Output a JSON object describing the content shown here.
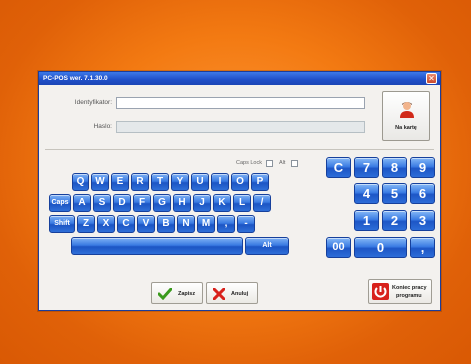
{
  "window": {
    "title": "PC-POS wer. 7.1.30.0",
    "close_glyph": "✕"
  },
  "login": {
    "identyfikator_label": "Identyfikator:",
    "identyfikator_value": "",
    "haslo_label": "Haslo:",
    "haslo_value": "",
    "card_button_label": "Na kartę",
    "card_icon": "user-icon"
  },
  "keyboard": {
    "caps_lock_label": "Caps Lock",
    "alt_label": "Alt",
    "row1": [
      "Q",
      "W",
      "E",
      "R",
      "T",
      "Y",
      "U",
      "I",
      "O",
      "P"
    ],
    "row2": [
      "Caps",
      "A",
      "S",
      "D",
      "F",
      "G",
      "H",
      "J",
      "K",
      "L",
      "/"
    ],
    "row3": [
      "Shift",
      "Z",
      "X",
      "C",
      "V",
      "B",
      "N",
      "M",
      ",",
      "-"
    ],
    "alt_key": "Alt"
  },
  "numpad": {
    "keys": [
      "C",
      "7",
      "8",
      "9",
      "4",
      "5",
      "6",
      "1",
      "2",
      "3",
      "00",
      "0",
      ","
    ]
  },
  "buttons": {
    "save_label": "Zapisz",
    "cancel_label": "Anuluj",
    "exit_label_line1": "Koniec pracy",
    "exit_label_line2": "programu"
  },
  "colors": {
    "background": "#f37a12",
    "titlebar": "#1f4fc8",
    "key_blue": "#2f6fd8"
  }
}
